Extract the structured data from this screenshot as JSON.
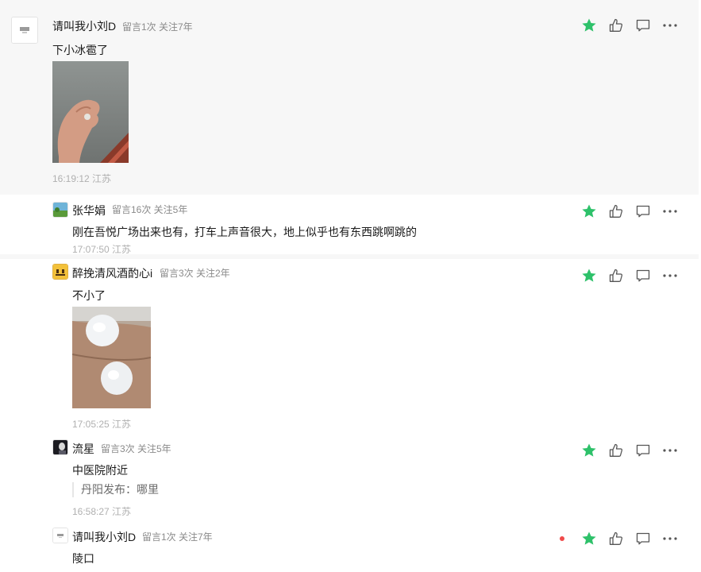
{
  "colors": {
    "star": "#2ec16a",
    "icon": "#555555",
    "red_dot": "#f04a4a",
    "time": "#b0b0b0",
    "meta": "#8a8a8a"
  },
  "comments": [
    {
      "user": "请叫我小刘D",
      "meta": "留言1次 关注7年",
      "text": "下小冰雹了",
      "time": "16:19:12 江苏",
      "avatar_icon": "default-avatar",
      "image": "hand-with-hailstone-photo"
    },
    {
      "user": "张华娟",
      "meta": "留言16次 关注5年",
      "text": "刚在吾悦广场出来也有，打车上声音很大，地上似乎也有东西跳啊跳的",
      "time": "17:07:50 江苏",
      "avatar_icon": "landscape-avatar"
    },
    {
      "user": "醉挽清风酒酌心i",
      "meta": "留言3次 关注2年",
      "text": "不小了",
      "time": "17:05:25 江苏",
      "avatar_icon": "cartoon-avatar",
      "image": "hailstones-in-palm-photo"
    },
    {
      "user": "流星",
      "meta": "留言3次 关注5年",
      "text": "中医院附近",
      "reply": "丹阳发布：哪里",
      "time": "16:58:27 江苏",
      "avatar_icon": "dark-portrait-avatar"
    },
    {
      "user": "请叫我小刘D",
      "meta": "留言1次 关注7年",
      "text": "陵口",
      "avatar_icon": "default-avatar"
    }
  ]
}
